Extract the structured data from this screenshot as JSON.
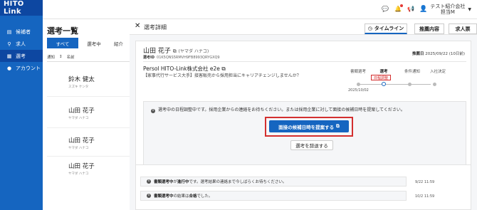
{
  "app": {
    "logo": "HITO Link"
  },
  "sidebar": {
    "items": [
      {
        "label": "候補者",
        "icon": "id-card-icon"
      },
      {
        "label": "求人",
        "icon": "search-icon"
      },
      {
        "label": "選考",
        "icon": "document-icon"
      },
      {
        "label": "アカウント",
        "icon": "person-icon"
      }
    ],
    "active_index": 2
  },
  "topbar": {
    "user_company": "テスト紹介会社",
    "user_name": "担当M"
  },
  "list": {
    "title": "選考一覧",
    "tabs": [
      "すべて",
      "選考中",
      "紹介"
    ],
    "active_tab": 0,
    "columns": [
      "通知",
      "名前"
    ],
    "candidates": [
      {
        "name": "鈴木 健太",
        "kana": "スズキ ケンタ"
      },
      {
        "name": "山田 花子",
        "kana": "ヤマダ ハナコ"
      },
      {
        "name": "山田 花子",
        "kana": "ヤマダ ハナコ"
      },
      {
        "name": "山田 花子",
        "kana": "ヤマダ ハナコ"
      }
    ]
  },
  "detail": {
    "title": "選考詳細",
    "tabs": {
      "timeline": "タイムライン",
      "recommendation": "推薦内容",
      "job": "求人票"
    },
    "candidate_name": "山田 花子",
    "candidate_kana": "(ヤマダ ハナコ)",
    "selection_id_label": "選考ID",
    "selection_id": "01K5QNS5RMVH9FB8993QRYGXQ9",
    "recommend_date_label": "推薦日",
    "recommend_date": "2025/09/22 (10日前)",
    "company": "Persol HITO-Link株式会社 e2e",
    "job_desc": "【家事代行サービス大手】接客販売から採用担当にキャリアチェンジしませんか？",
    "steps": [
      "書類選考",
      "選考",
      "条件通知",
      "入社決定"
    ],
    "current_step": 1,
    "current_badge": "日程調整",
    "step_date": "2025/10/02",
    "notice": "選考中の日程調整中です。採用企業からの連絡をお待ちください。または採用企業に対して面接の候補日時を提案してください。",
    "propose_button": "面接の候補日時を提案する",
    "decline_button": "選考を辞退する",
    "logs": [
      {
        "bold": "書類選考中",
        "text1": "が",
        "bold2": "進行中",
        "text2": "です。選考結果の連絡まで今しばらくお待ちください。",
        "time": "9/22 11:59"
      },
      {
        "bold": "書類選考中",
        "text1": "の結果は",
        "bold2": "合格",
        "text2": "でした。",
        "time": "10/2 11:59"
      }
    ]
  }
}
